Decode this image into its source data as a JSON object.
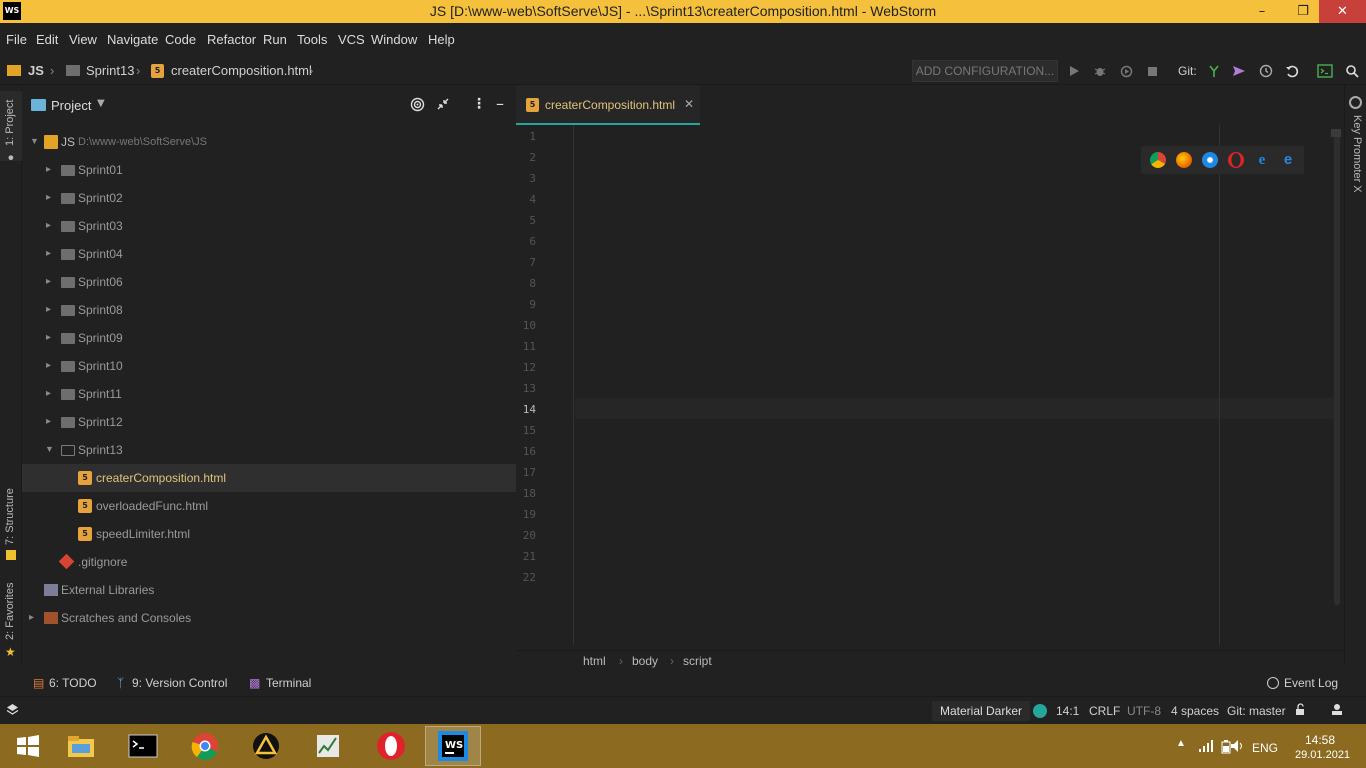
{
  "window": {
    "title": "JS [D:\\www-web\\SoftServe\\JS] - ...\\Sprint13\\createrComposition.html - WebStorm",
    "logo": "WS"
  },
  "menu": [
    "File",
    "Edit",
    "View",
    "Navigate",
    "Code",
    "Refactor",
    "Run",
    "Tools",
    "VCS",
    "Window",
    "Help"
  ],
  "breadcrumb": [
    "JS",
    "Sprint13",
    "createrComposition.html"
  ],
  "toolbar": {
    "add_configuration": "ADD CONFIGURATION...",
    "git_label": "Git:"
  },
  "left_tabs": {
    "project": "1: Project",
    "structure": "7: Structure",
    "favorites": "2: Favorites"
  },
  "right_tabs": {
    "key_promoter": "Key Promoter X"
  },
  "project_panel": {
    "title": "Project",
    "root_name": "JS",
    "root_path": "D:\\www-web\\SoftServe\\JS",
    "folders": [
      "Sprint01",
      "Sprint02",
      "Sprint03",
      "Sprint04",
      "Sprint06",
      "Sprint08",
      "Sprint09",
      "Sprint10",
      "Sprint11",
      "Sprint12",
      "Sprint13"
    ],
    "files": [
      "createrComposition.html",
      "overloadedFunc.html",
      "speedLimiter.html"
    ],
    "gitignore": ".gitignore",
    "external": "External Libraries",
    "scratches": "Scratches and Consoles"
  },
  "editor": {
    "tab": "createrComposition.html",
    "line_numbers": [
      "1",
      "2",
      "3",
      "4",
      "5",
      "6",
      "7",
      "8",
      "9",
      "10",
      "11",
      "12",
      "13",
      "14",
      "15",
      "16",
      "17",
      "18",
      "19",
      "20",
      "21",
      "22"
    ],
    "breadcrumb": [
      "html",
      "body",
      "script"
    ]
  },
  "bottom_tabs": {
    "todo": "6: TODO",
    "vcs": "9: Version Control",
    "terminal": "Terminal",
    "event_log": "Event Log"
  },
  "status": {
    "theme": "Material Darker",
    "position": "14:1",
    "line_sep": "CRLF",
    "encoding": "UTF-8",
    "indent": "4 spaces",
    "git": "Git: master"
  },
  "tray": {
    "lang": "ENG",
    "time": "14:58",
    "date": "29.01.2021"
  },
  "colors": {
    "accent": "#26a69a",
    "titlebar": "#f5c13d",
    "taskbar": "#8c6b20",
    "close": "#c7403a"
  }
}
